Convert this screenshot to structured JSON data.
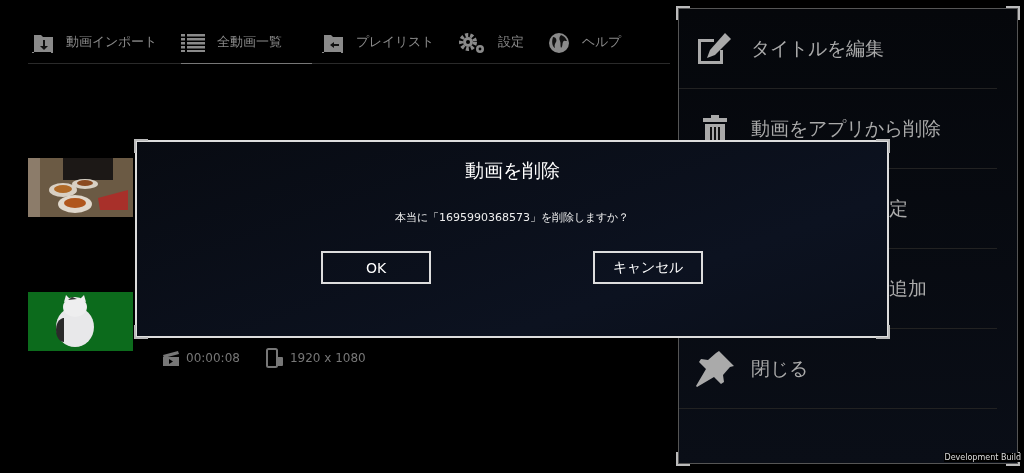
{
  "nav": [
    {
      "label": "動画インポート",
      "selected": false
    },
    {
      "label": "全動画一覧",
      "selected": true
    },
    {
      "label": "プレイリスト",
      "selected": false
    },
    {
      "label": "設定",
      "selected": false
    },
    {
      "label": "ヘルプ",
      "selected": false
    }
  ],
  "videos": [
    {
      "kind": "food"
    },
    {
      "kind": "cat",
      "duration": "00:00:08",
      "resolution": "1920 x 1080"
    }
  ],
  "menu": [
    {
      "label": "タイトルを編集"
    },
    {
      "label": "動画をアプリから削除"
    },
    {
      "label": "定"
    },
    {
      "label": "追加"
    },
    {
      "label": "閉じる"
    }
  ],
  "dialog": {
    "title": "動画を削除",
    "message": "本当に「1695990368573」を削除しますか？",
    "buttons": [
      "OK",
      "キャンセル"
    ]
  },
  "build_label": "Development Build"
}
